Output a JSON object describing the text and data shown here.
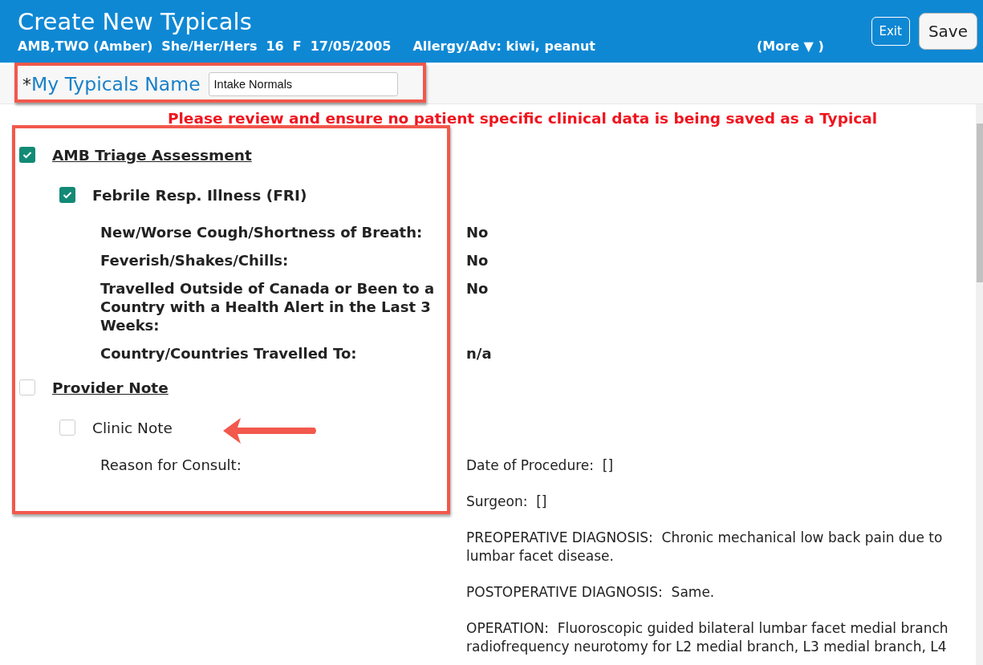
{
  "header": {
    "title": "Create New Typicals",
    "patient": [
      "AMB,TWO (Amber)",
      "She/Her/Hers",
      "16",
      "F",
      "17/05/2005",
      "Allergy/Adv: kiwi, peanut"
    ],
    "more": "(More ▼ )",
    "buttons": [
      {
        "kind": "outline",
        "label": "Exit"
      },
      {
        "kind": "solid",
        "label": "Save"
      }
    ]
  },
  "name_field": {
    "required_mark": "*",
    "label": "My Typicals Name",
    "value": "Intake Normals"
  },
  "warning": "Please review and ensure no patient specific clinical data is being saved as a Typical",
  "sections": [
    {
      "title": "AMB Triage Assessment",
      "checked": true,
      "children": [
        {
          "title": "Febrile Resp. Illness (FRI)",
          "checked": true,
          "fields": [
            {
              "label": "New/Worse Cough/Shortness of Breath:",
              "value": [
                "No"
              ]
            },
            {
              "label": "Feverish/Shakes/Chills:",
              "value": [
                "No"
              ]
            },
            {
              "label": "Travelled Outside of Canada or Been to a Country with a Health Alert in the Last 3 Weeks:",
              "value": [
                "No"
              ]
            },
            {
              "label": "Country/Countries Travelled To:",
              "value": [
                "n/a"
              ]
            }
          ]
        }
      ]
    },
    {
      "title": "Provider Note",
      "checked": false,
      "children": [
        {
          "title": "Clinic Note",
          "checked": false,
          "fields": [
            {
              "label": "Reason for Consult:",
              "value": [
                "Date of Procedure:  []",
                "Surgeon:  []",
                "PREOPERATIVE DIAGNOSIS:  Chronic mechanical low back pain due to lumbar facet disease.",
                "POSTOPERATIVE DIAGNOSIS:  Same.",
                "OPERATION:  Fluoroscopic guided bilateral lumbar facet medial branch radiofrequency neurotomy for L2 medial branch, L3 medial branch, L4"
              ]
            }
          ]
        }
      ]
    }
  ]
}
